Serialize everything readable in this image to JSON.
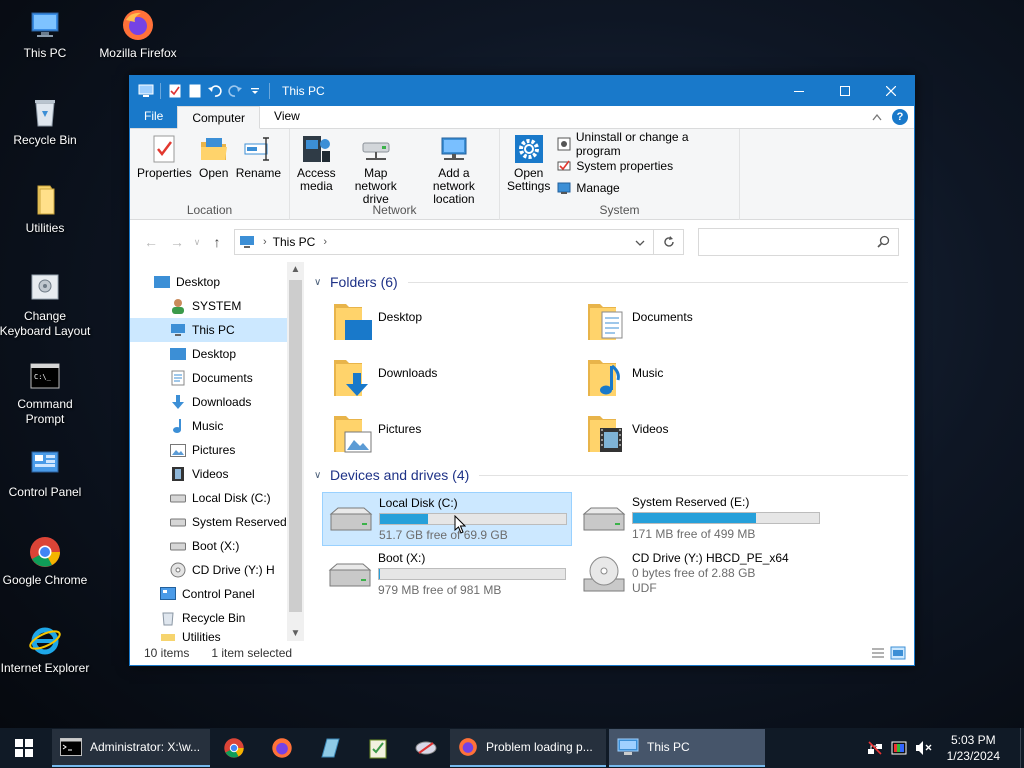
{
  "desktop": {
    "icons": [
      {
        "label": "This PC"
      },
      {
        "label": "Mozilla Firefox"
      },
      {
        "label": "Recycle Bin"
      },
      {
        "label": "Utilities"
      },
      {
        "label": "Change Keyboard Layout"
      },
      {
        "label": "Command Prompt"
      },
      {
        "label": "Control Panel"
      },
      {
        "label": "Google Chrome"
      },
      {
        "label": "Internet Explorer"
      }
    ]
  },
  "window": {
    "title": "This PC",
    "tabs": {
      "file": "File",
      "computer": "Computer",
      "view": "View"
    },
    "ribbon": {
      "location": {
        "label": "Location",
        "properties": "Properties",
        "open": "Open",
        "rename": "Rename"
      },
      "network": {
        "label": "Network",
        "access_media_1": "Access",
        "access_media_2": "media",
        "map_drive_1": "Map network",
        "map_drive_2": "drive",
        "add_location_1": "Add a network",
        "add_location_2": "location"
      },
      "system": {
        "label": "System",
        "open_settings_1": "Open",
        "open_settings_2": "Settings",
        "uninstall": "Uninstall or change a program",
        "system_properties": "System properties",
        "manage": "Manage"
      }
    },
    "address": {
      "crumb": "This PC",
      "search_placeholder": ""
    },
    "nav": {
      "desktop": "Desktop",
      "system": "SYSTEM",
      "this_pc": "This PC",
      "pc_desktop": "Desktop",
      "documents": "Documents",
      "downloads": "Downloads",
      "music": "Music",
      "pictures": "Pictures",
      "videos": "Videos",
      "local_disk": "Local Disk (C:)",
      "system_reserved": "System Reserved",
      "boot": "Boot (X:)",
      "cd_drive": "CD Drive (Y:) H",
      "control_panel": "Control Panel",
      "recycle_bin": "Recycle Bin",
      "utilities": "Utilities"
    },
    "folders": {
      "heading": "Folders (6)",
      "items": [
        "Desktop",
        "Documents",
        "Downloads",
        "Music",
        "Pictures",
        "Videos"
      ]
    },
    "drives": {
      "heading": "Devices and drives (4)",
      "items": [
        {
          "name": "Local Disk (C:)",
          "free": "51.7 GB free of 69.9 GB",
          "used_fraction": 0.26
        },
        {
          "name": "System Reserved (E:)",
          "free": "171 MB free of 499 MB",
          "used_fraction": 0.66
        },
        {
          "name": "Boot (X:)",
          "free": "979 MB free of 981 MB",
          "used_fraction": 0.002
        },
        {
          "name": "CD Drive (Y:) HBCD_PE_x64",
          "free": "0 bytes free of 2.88 GB",
          "fs": "UDF"
        }
      ]
    },
    "status": {
      "count": "10 items",
      "selected": "1 item selected"
    }
  },
  "taskbar": {
    "tasks": [
      {
        "label": "Administrator: X:\\w..."
      },
      {
        "label": "Problem loading p..."
      },
      {
        "label": "This PC"
      }
    ],
    "clock": {
      "time": "5:03 PM",
      "date": "1/23/2024"
    }
  },
  "colors": {
    "accent": "#1979ca",
    "bar_fill": "#26a0da",
    "selection": "#cce8ff"
  }
}
